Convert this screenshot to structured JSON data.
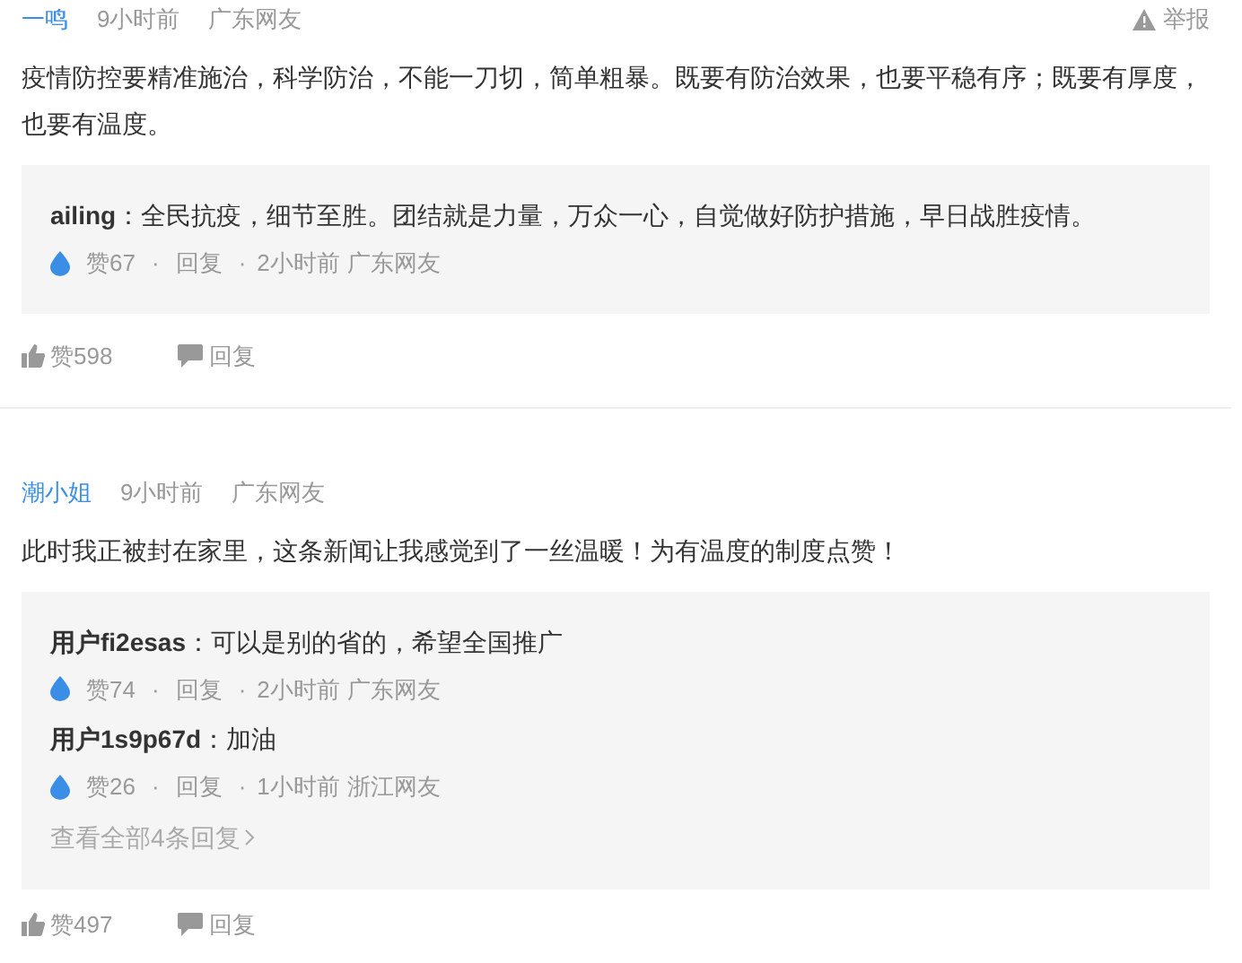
{
  "comments": [
    {
      "user": "一鸣",
      "time": "9小时前",
      "location": "广东网友",
      "report": "举报",
      "text": "疫情防控要精准施治，科学防治，不能一刀切，简单粗暴。既要有防治效果，也要平稳有序；既要有厚度，也要有温度。",
      "replies": [
        {
          "author": "ailing",
          "text": "：全民抗疫，细节至胜。团结就是力量，万众一心，自觉做好防护措施，早日战胜疫情。",
          "likes": "赞67",
          "separator": "·",
          "reply": "回复",
          "time": "2小时前",
          "location": "广东网友"
        }
      ],
      "likes": "赞598",
      "reply": "回复"
    },
    {
      "user": "潮小姐",
      "time": "9小时前",
      "location": "广东网友",
      "text": "此时我正被封在家里，这条新闻让我感觉到了一丝温暖！为有温度的制度点赞！",
      "replies": [
        {
          "author": "用户fi2esas",
          "text": "：可以是别的省的，希望全国推广",
          "likes": "赞74",
          "separator": "·",
          "reply": "回复",
          "time": "2小时前",
          "location": "广东网友"
        },
        {
          "author": "用户1s9p67d",
          "text": "：加油",
          "likes": "赞26",
          "separator": "·",
          "reply": "回复",
          "time": "1小时前",
          "location": "浙江网友"
        }
      ],
      "more": "查看全部4条回复",
      "likes": "赞497",
      "reply": "回复"
    }
  ]
}
